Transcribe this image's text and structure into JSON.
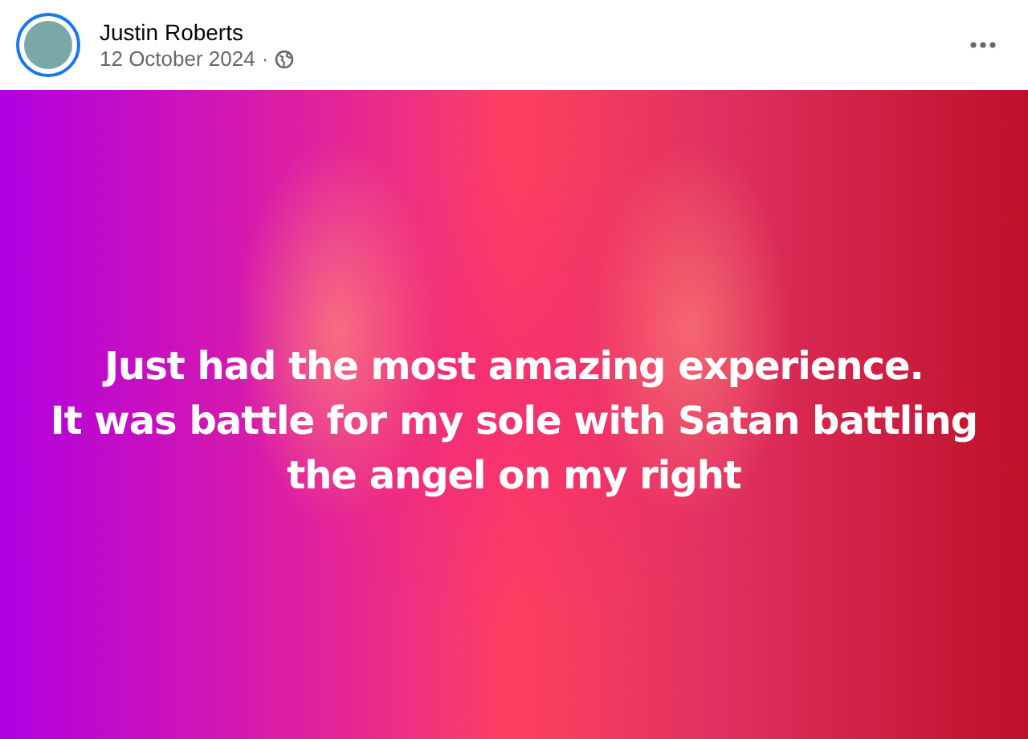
{
  "post": {
    "author": "Justin Roberts",
    "date": "12 October 2024",
    "separator": "·"
  },
  "body": {
    "lines": [
      "Just had the most amazing experience.",
      "It was battle for my sole with Satan battling",
      "the angel on my right"
    ]
  }
}
